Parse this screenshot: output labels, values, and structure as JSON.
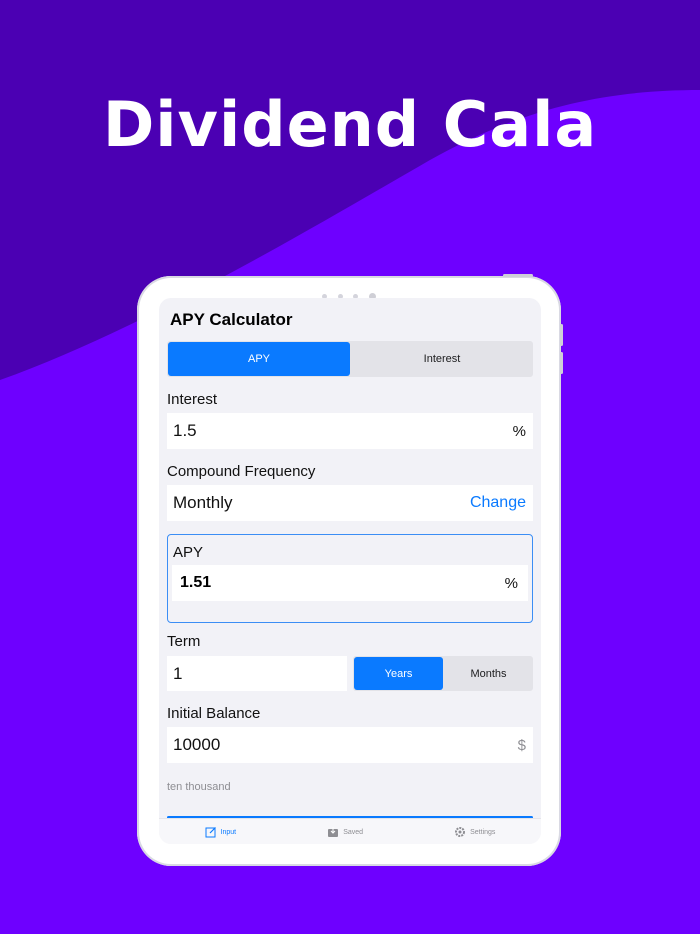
{
  "headline": "Dividend Cala",
  "app": {
    "title": "APY Calculator",
    "mode_tabs": [
      {
        "label": "APY",
        "active": true
      },
      {
        "label": "Interest",
        "active": false
      }
    ],
    "interest": {
      "label": "Interest",
      "value": "1.5",
      "unit": "%"
    },
    "compound": {
      "label": "Compound Frequency",
      "value": "Monthly",
      "action": "Change"
    },
    "apy": {
      "label": "APY",
      "value": "1.51",
      "unit": "%"
    },
    "term": {
      "label": "Term",
      "value": "1",
      "options": [
        {
          "label": "Years",
          "active": true
        },
        {
          "label": "Months",
          "active": false
        }
      ]
    },
    "initial_balance": {
      "label": "Initial Balance",
      "value": "10000",
      "unit": "$",
      "in_words": "ten thousand"
    },
    "tabbar": [
      {
        "label": "Input",
        "icon": "edit-icon",
        "active": true
      },
      {
        "label": "Saved",
        "icon": "tray-icon",
        "active": false
      },
      {
        "label": "Settings",
        "icon": "gear-icon",
        "active": false
      }
    ]
  },
  "colors": {
    "accent": "#0a7aff",
    "background_top": "#4b00b3",
    "background_bottom": "#6e00ff"
  }
}
